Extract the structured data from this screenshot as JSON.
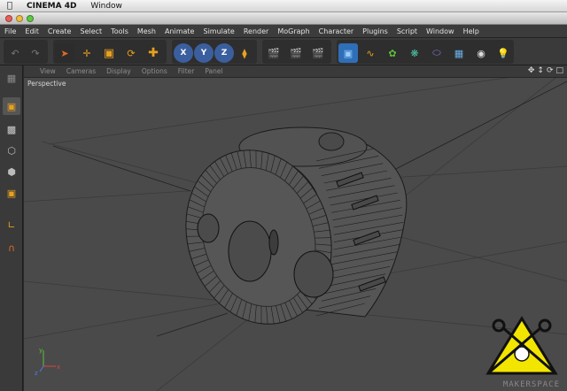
{
  "mac_menu": {
    "apple": "",
    "app_name": "CINEMA 4D",
    "window": "Window"
  },
  "menu": [
    "File",
    "Edit",
    "Create",
    "Select",
    "Tools",
    "Mesh",
    "Animate",
    "Simulate",
    "Render",
    "MoGraph",
    "Character",
    "Plugins",
    "Script",
    "Window",
    "Help"
  ],
  "viewport_menu": [
    "View",
    "Cameras",
    "Display",
    "Options",
    "Filter",
    "Panel"
  ],
  "viewport_label": "Perspective",
  "axis_labels": {
    "x": "x",
    "y": "y",
    "z": "z"
  },
  "toolbar": {
    "axis_x": "X",
    "axis_y": "Y",
    "axis_z": "Z"
  },
  "watermark": "MAKERSPACE",
  "colors": {
    "accent_orange": "#e8a020",
    "active_blue": "#3b5f9e",
    "wire": "#1a1a1a",
    "viewport_bg": "#4a4a4a"
  }
}
